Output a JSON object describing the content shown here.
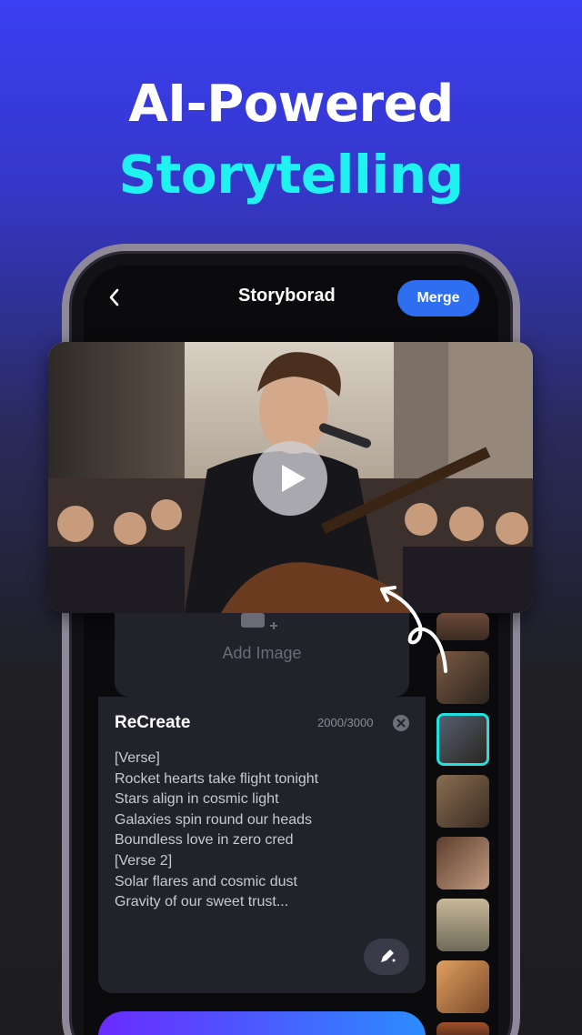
{
  "headline": {
    "line1": "AI-Powered",
    "line2": "Storytelling"
  },
  "topbar": {
    "title": "Storyborad",
    "merge_label": "Merge"
  },
  "add_image": {
    "label": "Add Image"
  },
  "recreate": {
    "title": "ReCreate",
    "counter": "2000/3000",
    "lyrics": [
      "[Verse]",
      "Rocket hearts take flight tonight",
      "Stars align in cosmic light",
      "Galaxies spin round our heads",
      "Boundless love in zero cred",
      "[Verse 2]",
      "Solar flares and cosmic dust",
      "Gravity of our sweet trust..."
    ]
  },
  "colors": {
    "accent": "#2e6ef0",
    "headline_accent": "#1ff2f0",
    "selected_border": "#21e0e0"
  },
  "icons": [
    "back-icon",
    "play-icon",
    "add-image-icon",
    "clear-icon",
    "edit-icon"
  ]
}
